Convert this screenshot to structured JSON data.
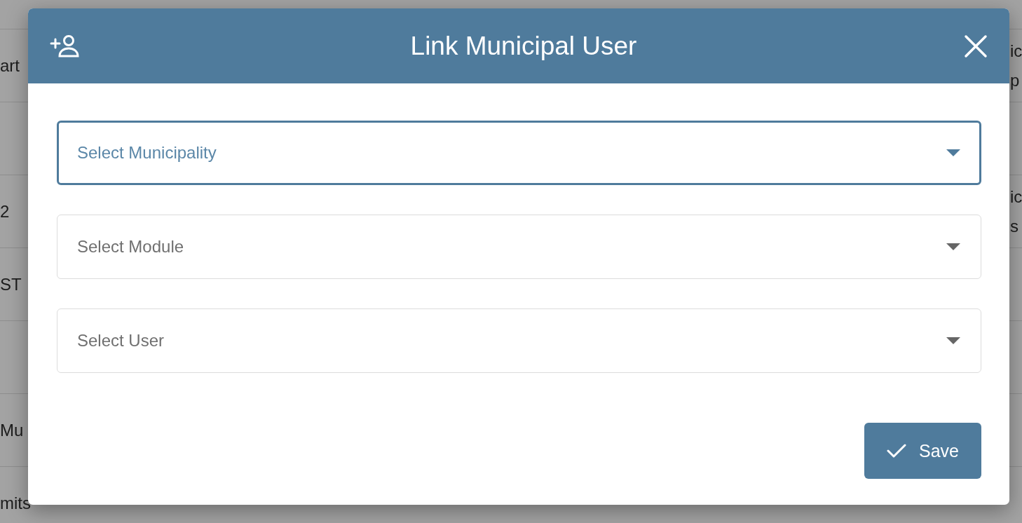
{
  "background_table": {
    "rows": [
      {
        "name": "art",
        "edge": [
          "ic",
          "p"
        ]
      },
      {},
      {
        "name": "2",
        "edge": [
          "ic",
          "s"
        ]
      },
      {
        "name": "ST"
      },
      {},
      {
        "name": "Mu"
      },
      {
        "name": "mits"
      }
    ]
  },
  "dialog": {
    "title": "Link Municipal User",
    "fields": [
      {
        "placeholder": "Select Municipality",
        "focused": true
      },
      {
        "placeholder": "Select Module",
        "focused": false
      },
      {
        "placeholder": "Select User",
        "focused": false
      }
    ],
    "save_button": "Save"
  }
}
